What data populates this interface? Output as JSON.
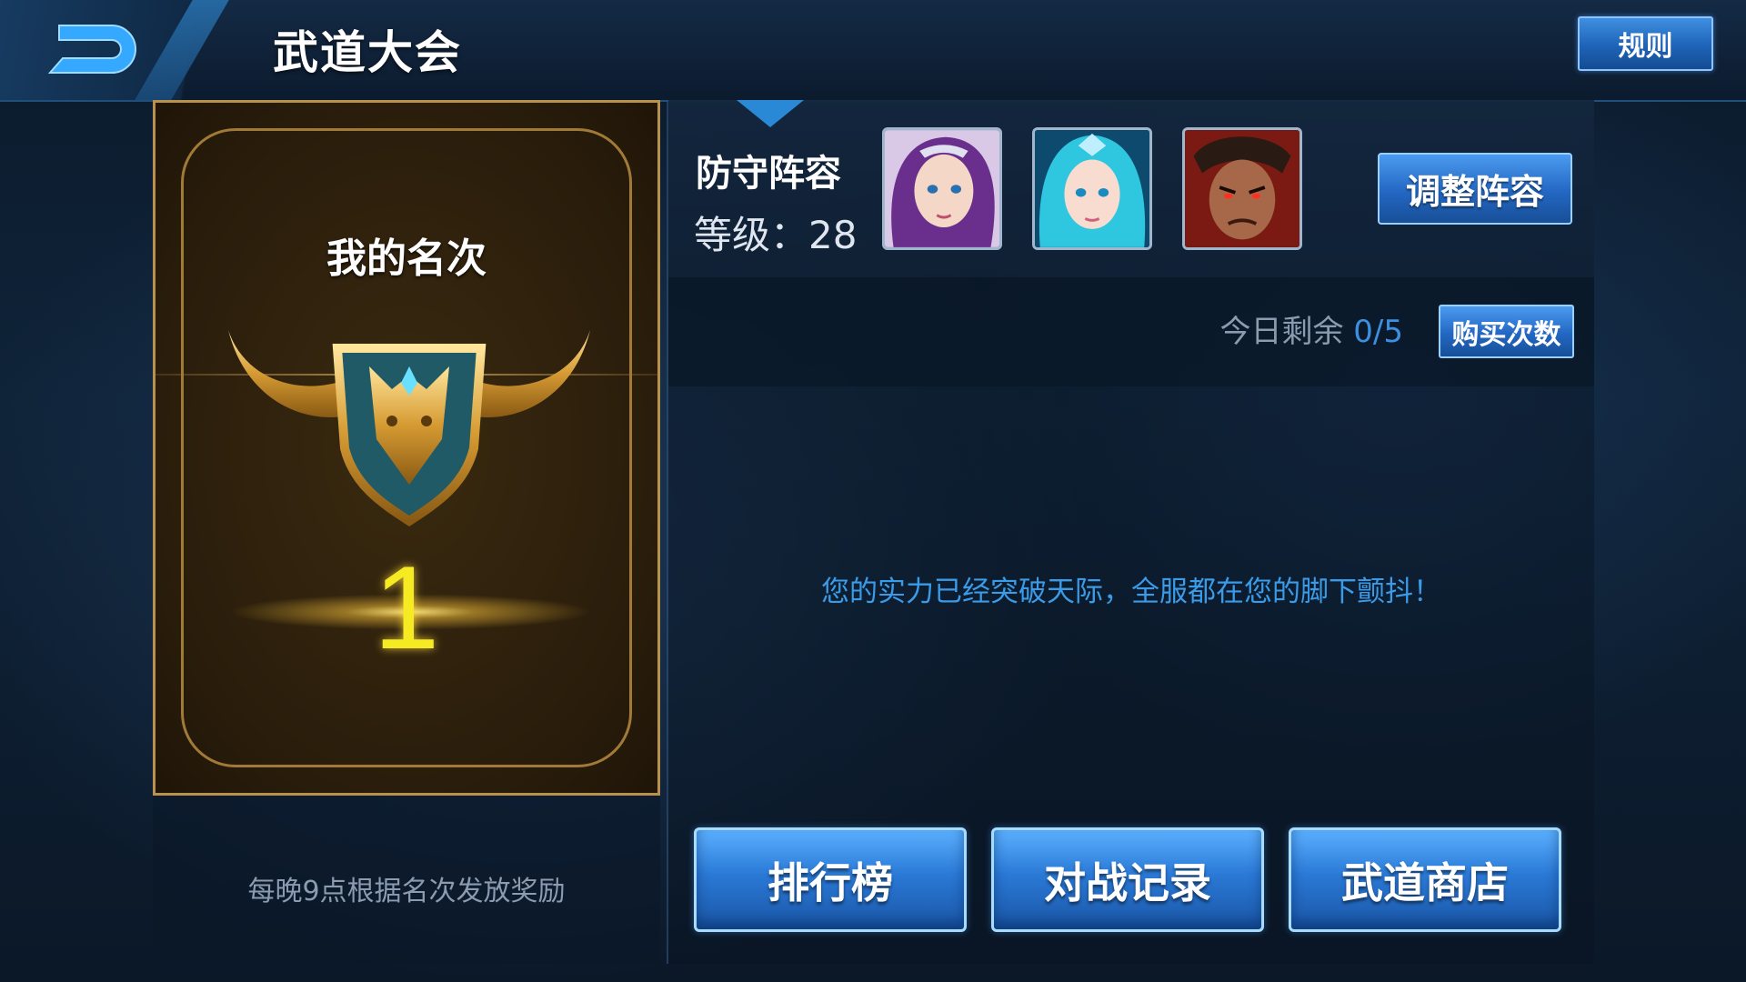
{
  "header": {
    "title": "武道大会",
    "rules_label": "规则"
  },
  "rank_card": {
    "title": "我的名次",
    "rank": "1",
    "reward_note": "每晚9点根据名次发放奖励"
  },
  "defense": {
    "title": "防守阵容",
    "level_label": "等级：",
    "level": "28",
    "heroes": [
      "hero-portrait-purple-hair",
      "hero-portrait-cyan-hair",
      "hero-portrait-red-warrior"
    ],
    "adjust_label": "调整阵容"
  },
  "attempts": {
    "label": "今日剩余",
    "value": "0/5",
    "buy_label": "购买次数"
  },
  "message": "您的实力已经突破天际，全服都在您的脚下颤抖！",
  "actions": {
    "leaderboard": "排行榜",
    "battle_record": "对战记录",
    "shop": "武道商店"
  },
  "colors": {
    "accent_blue": "#2a79d6",
    "rank_gold": "#f6ea22",
    "message_blue": "#3a9be8"
  }
}
